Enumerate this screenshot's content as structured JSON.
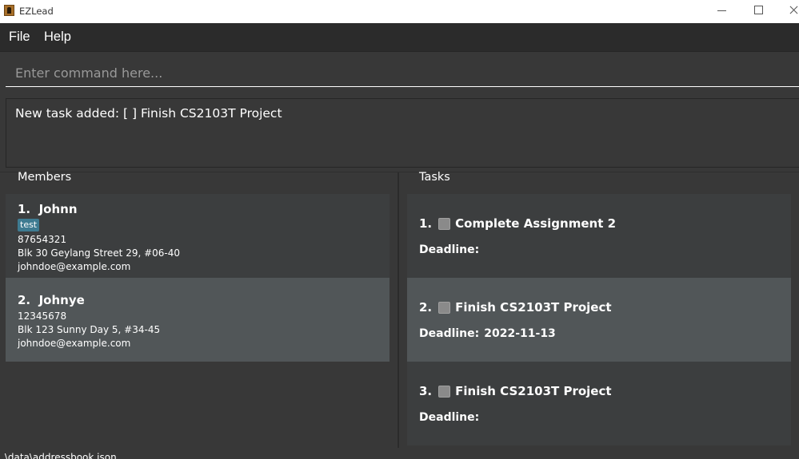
{
  "window": {
    "title": "EZLead"
  },
  "menu": {
    "file": "File",
    "help": "Help"
  },
  "command": {
    "placeholder": "Enter command here..."
  },
  "result": {
    "text": "New task added: [ ] Finish CS2103T Project"
  },
  "members": {
    "title": "Members",
    "items": [
      {
        "index": "1.",
        "name": "Johnn",
        "tag": "test",
        "phone": "87654321",
        "address": "Blk 30 Geylang Street 29, #06-40",
        "email": "johndoe@example.com"
      },
      {
        "index": "2.",
        "name": "Johnye",
        "phone": "12345678",
        "address": "Blk 123 Sunny Day 5, #34-45",
        "email": "johndoe@example.com"
      }
    ]
  },
  "tasks": {
    "title": "Tasks",
    "deadline_label": "Deadline:",
    "items": [
      {
        "index": "1.",
        "name": "Complete Assignment 2",
        "deadline": ""
      },
      {
        "index": "2.",
        "name": "Finish CS2103T Project",
        "deadline": "2022-11-13"
      },
      {
        "index": "3.",
        "name": "Finish CS2103T Project",
        "deadline": ""
      }
    ]
  },
  "status": {
    "path": ".\\data\\addressbook.json"
  },
  "colors": {
    "background": "#383838",
    "selected_card": "#515658",
    "tag": "#3e7b91"
  }
}
